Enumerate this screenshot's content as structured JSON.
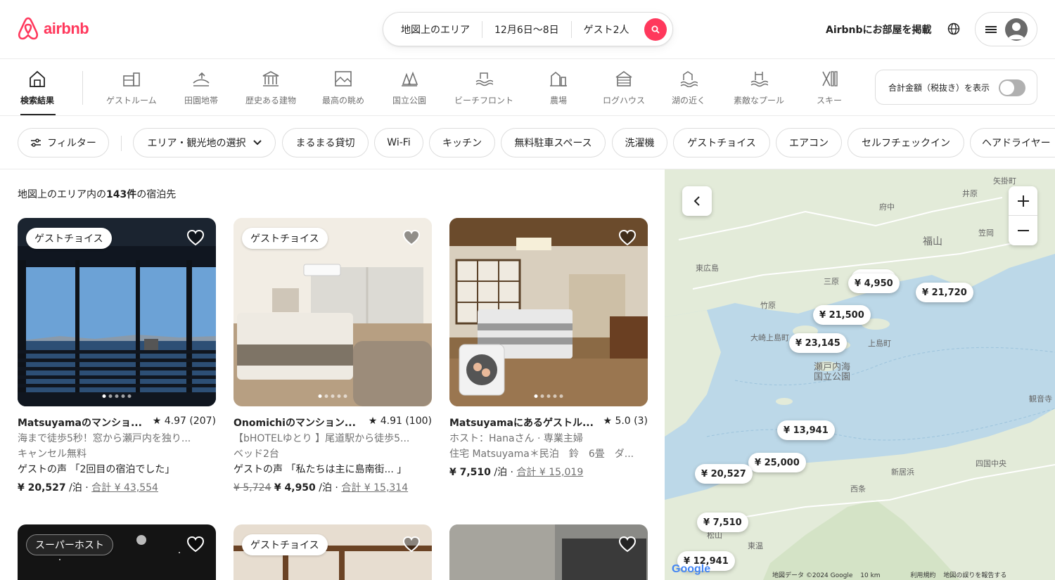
{
  "header": {
    "logo_text": "airbnb",
    "search": {
      "where": "地図上のエリア",
      "when": "12月6日〜8日",
      "who": "ゲスト2人"
    },
    "host_link": "Airbnbにお部屋を掲載"
  },
  "categories": [
    {
      "label": "検索結果",
      "icon": "search-results-icon",
      "active": true
    },
    {
      "label": "ゲストルーム",
      "icon": "guest-room-icon"
    },
    {
      "label": "田園地帯",
      "icon": "countryside-icon"
    },
    {
      "label": "歴史ある建物",
      "icon": "historic-building-icon"
    },
    {
      "label": "最高の眺め",
      "icon": "amazing-view-icon"
    },
    {
      "label": "国立公園",
      "icon": "national-park-icon"
    },
    {
      "label": "ビーチフロント",
      "icon": "beachfront-icon"
    },
    {
      "label": "農場",
      "icon": "farm-icon"
    },
    {
      "label": "ログハウス",
      "icon": "cabin-icon"
    },
    {
      "label": "湖の近く",
      "icon": "lake-icon"
    },
    {
      "label": "素敵なプール",
      "icon": "pool-icon"
    },
    {
      "label": "スキー",
      "icon": "ski-icon"
    }
  ],
  "total_toggle_label": "合計金額（税抜き）を表示",
  "filters": {
    "filter_button": "フィルター",
    "area_select": "エリア・観光地の選択",
    "chips": [
      "まるまる貸切",
      "Wi-Fi",
      "キッチン",
      "無料駐車スペース",
      "洗濯機",
      "ゲストチョイス",
      "エアコン",
      "セルフチェックイン",
      "ヘアドライヤー"
    ]
  },
  "results": {
    "prefix": "地図上のエリア内の",
    "count": "143件",
    "suffix": "の宿泊先"
  },
  "listings": [
    {
      "badge": "ゲストチョイス",
      "title": "Matsuyamaのマンショ...",
      "rating": "★ 4.97 (207)",
      "line1": "海まで徒歩5秒！窓から瀬戸内を独り...",
      "line2": "キャンセル無料",
      "line3": "ゲストの声 「2回目の宿泊でした」",
      "old_price": "",
      "price": "¥ 20,527",
      "per": " /泊 · ",
      "total": "合計 ¥ 43,554"
    },
    {
      "badge": "ゲストチョイス",
      "title": "Onomichiのマンション...",
      "rating": "★ 4.91 (100)",
      "line1": "【bHOTELゆとり 】尾道駅から徒歩5...",
      "line2": "ベッド2台",
      "line3": "ゲストの声 「私たちは主に島南街... 」",
      "old_price": "¥ 5,724",
      "price": "¥ 4,950",
      "per": " /泊 · ",
      "total": "合計 ¥ 15,314"
    },
    {
      "badge": "",
      "title": "Matsuyamaにあるゲストル...",
      "rating": "★ 5.0 (3)",
      "line1": "ホスト：Hanaさん · 専業主婦",
      "line2": "住宅 Matsuyama＊民泊　鈴　6畳　ダ...",
      "line3": "",
      "old_price": "",
      "price": "¥ 7,510",
      "per": " /泊 · ",
      "total": "合計 ¥ 15,019"
    }
  ],
  "listings_row2_badges": [
    "スーパーホスト",
    "ゲストチョイス",
    ""
  ],
  "map": {
    "pins": [
      "¥ 4,950",
      "¥ 21,720",
      "¥ 21,500",
      "¥ 23,145",
      "¥ 13,941",
      "¥ 25,000",
      "¥ 20,527",
      "¥ 7,510",
      "¥ 12,941"
    ],
    "labels": [
      "矢掛町",
      "井原",
      "府中",
      "笠岡",
      "福山",
      "東広島",
      "三原",
      "竹原",
      "大崎上島町",
      "上島町",
      "瀬戸内海",
      "国立公園",
      "観音寺",
      "新居浜",
      "四国中央",
      "西条",
      "東温",
      "松山"
    ],
    "footer": {
      "data": "地図データ ©2024 Google",
      "scale": "10 km",
      "terms": "利用規約",
      "report": "地図の誤りを報告する"
    },
    "google": "Google"
  }
}
